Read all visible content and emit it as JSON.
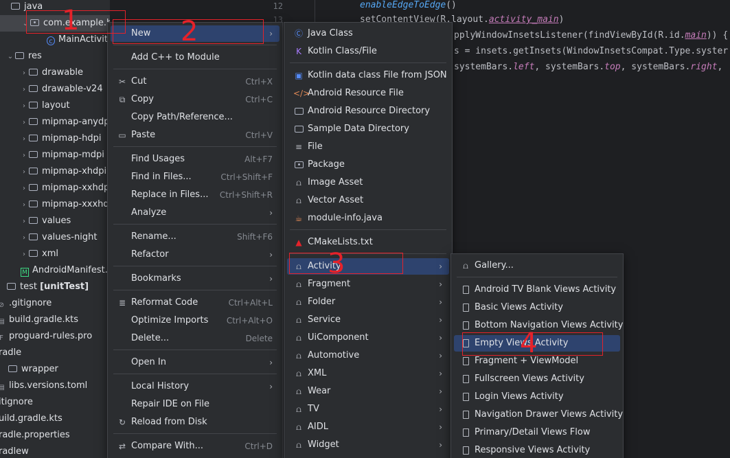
{
  "tree": {
    "items": [
      {
        "label": "java",
        "icon": "folder-icon"
      },
      {
        "label": "com.example.h",
        "icon": "package-icon"
      },
      {
        "label": "MainActivity",
        "icon": "class-icon"
      },
      {
        "label": "res",
        "icon": "folder-icon"
      },
      {
        "label": "drawable"
      },
      {
        "label": "drawable-v24"
      },
      {
        "label": "layout"
      },
      {
        "label": "mipmap-anydp"
      },
      {
        "label": "mipmap-hdpi"
      },
      {
        "label": "mipmap-mdpi"
      },
      {
        "label": "mipmap-xhdpi"
      },
      {
        "label": "mipmap-xxhdp"
      },
      {
        "label": "mipmap-xxxhdp"
      },
      {
        "label": "values"
      },
      {
        "label": "values-night"
      },
      {
        "label": "xml"
      },
      {
        "label": "AndroidManifest.x"
      },
      {
        "label": "test",
        "suffix": "[unitTest]"
      },
      {
        "label": ".gitignore"
      },
      {
        "label": "build.gradle.kts"
      },
      {
        "label": "proguard-rules.pro"
      },
      {
        "label": "radle"
      },
      {
        "label": "wrapper"
      },
      {
        "label": "libs.versions.toml"
      },
      {
        "label": "itignore"
      },
      {
        "label": "uild.gradle.kts"
      },
      {
        "label": "radle.properties"
      },
      {
        "label": "radlew"
      }
    ]
  },
  "editor": {
    "line_numbers": [
      "12",
      "13"
    ],
    "lines": [
      {
        "p1": "enableEdgeToEdge",
        "p2": "()"
      },
      {
        "p1": "setContentView(R.layout.",
        "p2": "activity_main",
        "p3": ")"
      },
      {
        "p1": "pplyWindowInsetsListener(findViewById(R.id.",
        "p2": "main",
        "p3": ")) {"
      },
      {
        "p1": "s = insets.getInsets(WindowInsetsCompat.Type.syster"
      },
      {
        "p1": "systemBars.",
        "p2": "left",
        "p3": ", systemBars.",
        "p4": "top",
        "p5": ", systemBars.",
        "p6": "right",
        "p7": ","
      }
    ]
  },
  "context_menu": {
    "items": [
      {
        "label": "New",
        "arrow": "›"
      },
      {
        "label": "Add C++ to Module"
      },
      {
        "label": "Cut",
        "shortcut": "Ctrl+X"
      },
      {
        "label": "Copy",
        "shortcut": "Ctrl+C"
      },
      {
        "label": "Copy Path/Reference..."
      },
      {
        "label": "Paste",
        "shortcut": "Ctrl+V"
      },
      {
        "label": "Find Usages",
        "shortcut": "Alt+F7"
      },
      {
        "label": "Find in Files...",
        "shortcut": "Ctrl+Shift+F"
      },
      {
        "label": "Replace in Files...",
        "shortcut": "Ctrl+Shift+R"
      },
      {
        "label": "Analyze",
        "arrow": "›"
      },
      {
        "label": "Rename...",
        "shortcut": "Shift+F6"
      },
      {
        "label": "Refactor",
        "arrow": "›"
      },
      {
        "label": "Bookmarks",
        "arrow": "›"
      },
      {
        "label": "Reformat Code",
        "shortcut": "Ctrl+Alt+L"
      },
      {
        "label": "Optimize Imports",
        "shortcut": "Ctrl+Alt+O"
      },
      {
        "label": "Delete...",
        "shortcut": "Delete"
      },
      {
        "label": "Open In",
        "arrow": "›"
      },
      {
        "label": "Local History",
        "arrow": "›"
      },
      {
        "label": "Repair IDE on File"
      },
      {
        "label": "Reload from Disk"
      },
      {
        "label": "Compare With...",
        "shortcut": "Ctrl+D"
      }
    ]
  },
  "new_menu": {
    "items": [
      {
        "label": "Java Class"
      },
      {
        "label": "Kotlin Class/File"
      },
      {
        "label": "Kotlin data class File from JSON"
      },
      {
        "label": "Android Resource File"
      },
      {
        "label": "Android Resource Directory"
      },
      {
        "label": "Sample Data Directory"
      },
      {
        "label": "File"
      },
      {
        "label": "Package"
      },
      {
        "label": "Image Asset"
      },
      {
        "label": "Vector Asset"
      },
      {
        "label": "module-info.java"
      },
      {
        "label": "CMakeLists.txt"
      },
      {
        "label": "Activity",
        "arrow": "›"
      },
      {
        "label": "Fragment",
        "arrow": "›"
      },
      {
        "label": "Folder",
        "arrow": "›"
      },
      {
        "label": "Service",
        "arrow": "›"
      },
      {
        "label": "UiComponent",
        "arrow": "›"
      },
      {
        "label": "Automotive",
        "arrow": "›"
      },
      {
        "label": "XML",
        "arrow": "›"
      },
      {
        "label": "Wear",
        "arrow": "›"
      },
      {
        "label": "TV",
        "arrow": "›"
      },
      {
        "label": "AIDL",
        "arrow": "›"
      },
      {
        "label": "Widget",
        "arrow": "›"
      }
    ]
  },
  "activity_menu": {
    "items": [
      {
        "label": "Gallery..."
      },
      {
        "label": "Android TV Blank Views Activity"
      },
      {
        "label": "Basic Views Activity"
      },
      {
        "label": "Bottom Navigation Views Activity"
      },
      {
        "label": "Empty Views Activity"
      },
      {
        "label": "Fragment + ViewModel"
      },
      {
        "label": "Fullscreen Views Activity"
      },
      {
        "label": "Login Views Activity"
      },
      {
        "label": "Navigation Drawer Views Activity"
      },
      {
        "label": "Primary/Detail Views Flow"
      },
      {
        "label": "Responsive Views Activity"
      }
    ]
  },
  "annotations": [
    "1",
    "2",
    "3",
    "4"
  ],
  "colors": {
    "annotation": "#e5222a",
    "highlight": "#2e436e",
    "menu_bg": "#2b2d30",
    "android_green": "#3ddc84"
  }
}
